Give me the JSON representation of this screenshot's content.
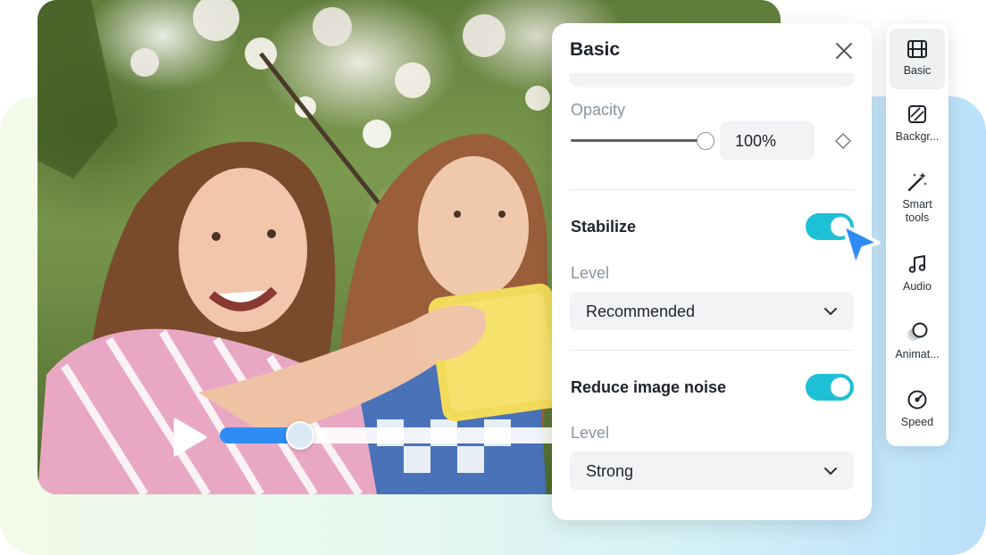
{
  "video": {
    "play_icon": "play-icon",
    "progress": 0.2,
    "progress_color": "#2f8cf4"
  },
  "panel": {
    "title": "Basic",
    "close_icon": "close-icon",
    "opacity": {
      "label": "Opacity",
      "value": "100%",
      "slider_level": 1.0,
      "keyframe_icon": "diamond-keyframe-icon"
    },
    "stabilize": {
      "label": "Stabilize",
      "enabled": true,
      "level_label": "Level",
      "level_value": "Recommended"
    },
    "noise": {
      "label": "Reduce image noise",
      "enabled": true,
      "level_label": "Level",
      "level_value": "Strong"
    },
    "toggle_color": "#1ec0d6"
  },
  "cursor_color": "#2f8cf4",
  "toolbar": {
    "items": [
      {
        "icon": "film-icon",
        "label": "Basic",
        "active": true
      },
      {
        "icon": "background-icon",
        "label": "Backgr..."
      },
      {
        "icon": "magic-wand-icon",
        "label": "Smart tools"
      },
      {
        "icon": "music-note-icon",
        "label": "Audio"
      },
      {
        "icon": "animation-icon",
        "label": "Animat..."
      },
      {
        "icon": "speed-icon",
        "label": "Speed"
      }
    ]
  }
}
